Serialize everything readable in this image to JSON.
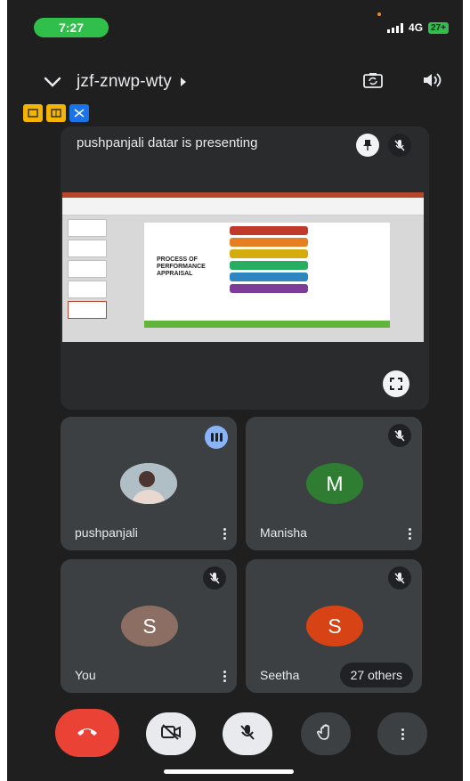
{
  "status_bar": {
    "time": "7:27",
    "network": "4G",
    "battery": "27+"
  },
  "meeting": {
    "code": "jzf-znwp-wty"
  },
  "presentation": {
    "label": "pushpanjali datar is presenting",
    "slide_title": "PROCESS OF PERFORMANCE APPRAISAL"
  },
  "participants": [
    {
      "name": "pushpanjali",
      "initial": "",
      "avatar_color": "#cfd8dc",
      "status": "speaking"
    },
    {
      "name": "Manisha",
      "initial": "M",
      "avatar_color": "#2e7d32",
      "status": "muted"
    },
    {
      "name": "You",
      "initial": "S",
      "avatar_color": "#8d6e63",
      "status": "muted"
    },
    {
      "name": "Seetha",
      "initial": "S",
      "avatar_color": "#d84315",
      "status": "muted"
    }
  ],
  "others_label": "27 others",
  "colors": {
    "background": "#1f1f1f",
    "tile": "#3c4043",
    "end_call": "#ea4335",
    "control": "#3c4043",
    "control_light": "#e8eaed"
  },
  "icons": [
    "chevron-down-icon",
    "camera-switch-icon",
    "speaker-icon",
    "pin-icon",
    "mic-off-icon",
    "fullscreen-icon",
    "hangup-icon",
    "camera-off-icon",
    "raise-hand-icon",
    "more-options-icon"
  ]
}
